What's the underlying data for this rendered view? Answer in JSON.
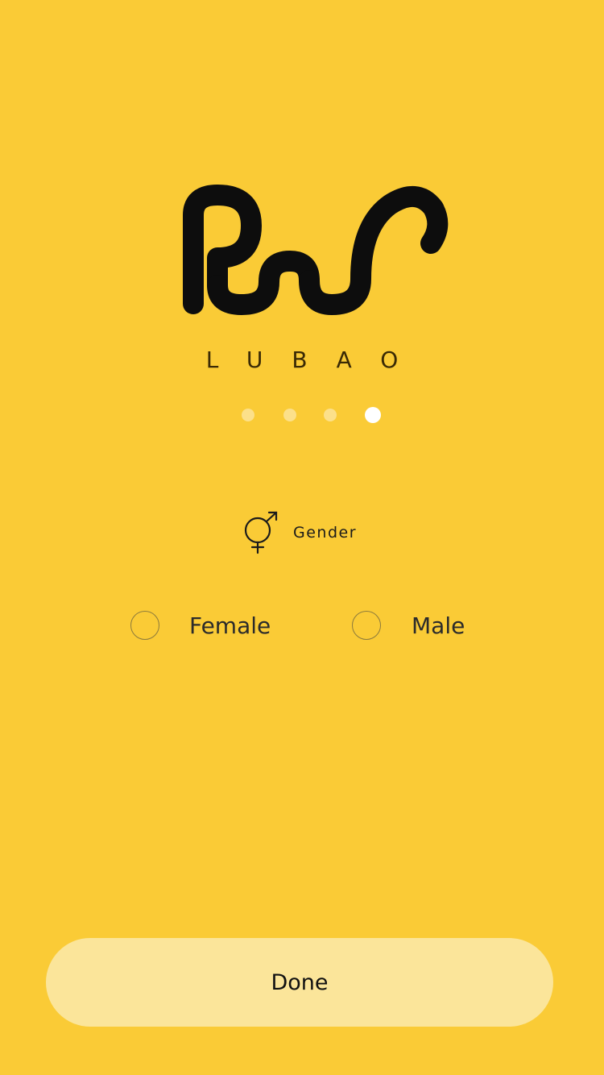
{
  "colors": {
    "background": "#FACB36",
    "dot_inactive": "#FCE08A",
    "dot_active": "#FFFFFF",
    "done_button": "#FBE59A",
    "logo": "#0d0d0d"
  },
  "logo": {
    "subtitle": "LUBAO"
  },
  "pager": {
    "total": 4,
    "active_index": 3
  },
  "gender": {
    "icon": "gender-icon",
    "label": "Gender",
    "options": [
      {
        "label": "Female",
        "selected": false
      },
      {
        "label": "Male",
        "selected": false
      }
    ]
  },
  "actions": {
    "done_label": "Done"
  }
}
